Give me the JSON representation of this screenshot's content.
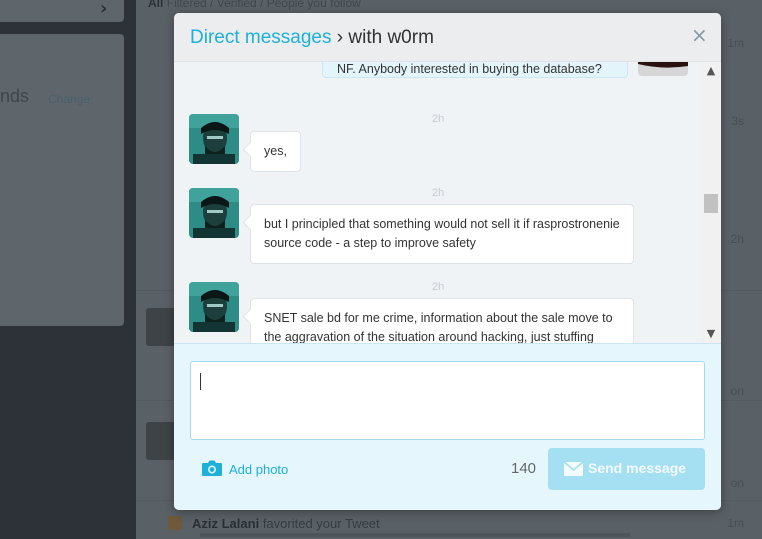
{
  "background": {
    "left_panel": {
      "heading": "nds",
      "change_link": "Change"
    },
    "tabs_text": {
      "all": "All",
      "rest": "Filtered / Verified / People you follow"
    },
    "times": [
      "1m",
      "3s",
      "2h",
      "on",
      "on",
      "1m"
    ],
    "notification": {
      "name": "Aziz Lalani",
      "action": "favorited your Tweet"
    }
  },
  "modal": {
    "title_link": "Direct messages",
    "title_separator": "›",
    "title_rest": "with w0rm",
    "close_icon": "×"
  },
  "conversation": {
    "sent_message": "NF. Anybody interested in buying the database?",
    "messages": [
      {
        "time": "2h",
        "text": "yes,"
      },
      {
        "time": "2h",
        "text": "but I principled that something would not sell it if rasprostronenie source code - a step to improve safety"
      },
      {
        "time": "2h",
        "text": "SNET sale bd for me crime, information about the sale move to the aggravation of the situation around hacking, just stuffing"
      }
    ]
  },
  "compose": {
    "input_value": "",
    "add_photo_label": "Add photo",
    "char_count": "140",
    "send_label": "Send message"
  },
  "colors": {
    "accent": "#1db0d8",
    "send_button_disabled": "#a4dff2",
    "modal_bg": "#eff3f5",
    "compose_bg": "#e5f6fd"
  },
  "icons": {
    "close": "close-icon",
    "camera": "camera-icon",
    "send": "envelope-icon",
    "scroll_up": "chevron-up-icon",
    "scroll_down": "chevron-down-icon"
  }
}
